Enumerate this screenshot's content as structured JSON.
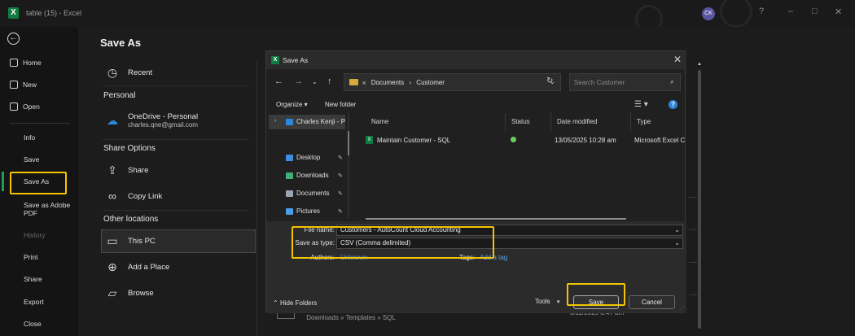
{
  "window": {
    "app_logo": "X",
    "title": "table (15)  -  Excel",
    "avatar_initials": "CK",
    "controls": {
      "minimize": "–",
      "maximize": "□",
      "close": "✕",
      "help": "?"
    }
  },
  "nav": {
    "back_icon": "←",
    "items": [
      {
        "label": "Home",
        "icon": "home-icon"
      },
      {
        "label": "New",
        "icon": "new-file-icon"
      },
      {
        "label": "Open",
        "icon": "folder-open-icon"
      }
    ],
    "plain_items": [
      "Info",
      "Save",
      "Save As",
      "Save as Adobe PDF",
      "History",
      "Print",
      "Share",
      "Export",
      "Close"
    ],
    "active": "Save As",
    "disabled": "History"
  },
  "save_as_panel": {
    "title": "Save As",
    "recent": "Recent",
    "personal_heading": "Personal",
    "onedrive": {
      "label": "OneDrive - Personal",
      "email": "charles.qne@gmail.com"
    },
    "share_heading": "Share Options",
    "share": "Share",
    "copy_link": "Copy Link",
    "other_heading": "Other locations",
    "this_pc": "This PC",
    "add_place": "Add a Place",
    "browse": "Browse",
    "bg_row_path": "Downloads » Templates » SQL",
    "bg_row_date": "3/11/2025 8:47 am"
  },
  "dialog": {
    "title": "Save As",
    "close": "✕",
    "address": {
      "prefix": "«",
      "part1": "Documents",
      "sep": "›",
      "part2": "Customer"
    },
    "search_placeholder": "Search Customer",
    "organize": "Organize ▾",
    "new_folder": "New folder",
    "tree": {
      "top": "Charles Kenji - P",
      "pinned": [
        "Desktop",
        "Downloads",
        "Documents",
        "Pictures"
      ]
    },
    "columns": [
      "Name",
      "Status",
      "Date modified",
      "Type"
    ],
    "files": [
      {
        "name": "Maintain Customer - SQL",
        "date": "13/05/2025 10:28 am",
        "type": "Microsoft Excel C"
      }
    ],
    "form": {
      "file_name_label": "File name:",
      "file_name_value": "Customers - AutoCount Cloud Accounting",
      "save_type_label": "Save as type:",
      "save_type_value": "CSV (Comma delimited)",
      "authors_label": "Authors:",
      "authors_value": "Unknown",
      "tags_label": "Tags:",
      "tags_value": "Add a tag"
    },
    "hide_folders": "Hide Folders",
    "tools": "Tools",
    "save": "Save",
    "cancel": "Cancel"
  },
  "highlight_color": "#f4c400",
  "accent_color": "#107c41"
}
